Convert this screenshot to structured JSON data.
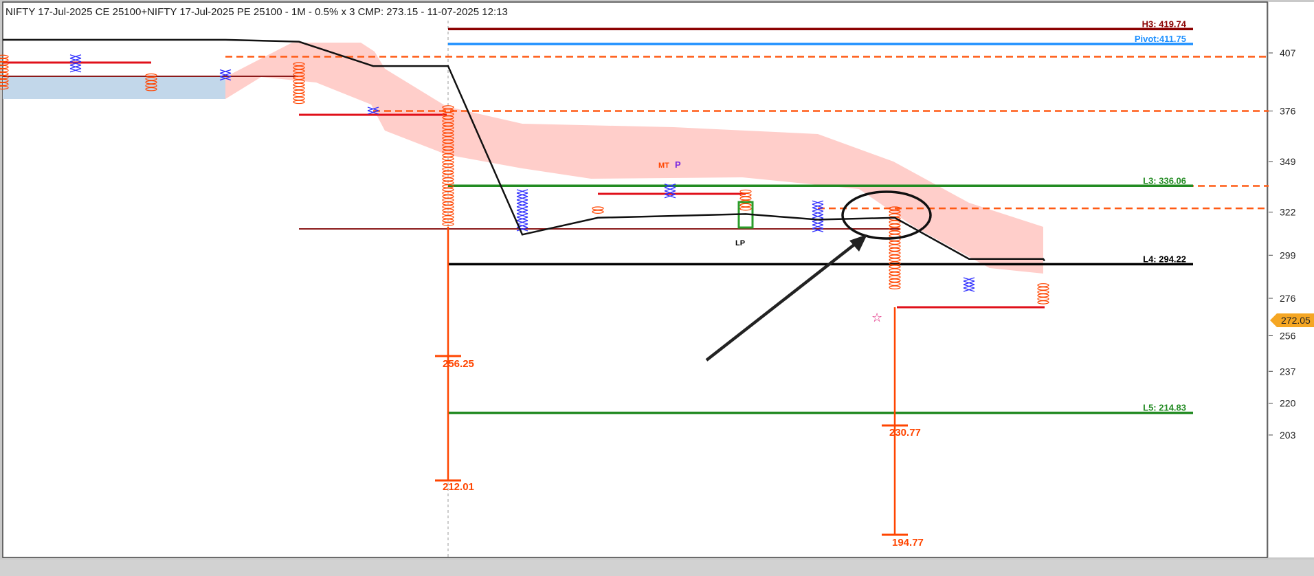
{
  "title": "NIFTY 17-Jul-2025 CE 25100+NIFTY 17-Jul-2025 PE 25100 - 1M - 0.5% x 3 CMP: 273.15 - 11-07-2025 12:13",
  "chart_data": {
    "type": "line",
    "ylim": [
      188,
      425
    ],
    "y_ticks": [
      407,
      376,
      349,
      322,
      299,
      276,
      256,
      237,
      220,
      203
    ],
    "current_price": "272.05",
    "colors": {
      "price_line": "#000000",
      "ribbon": "#ffc9c4",
      "dashed": "#ff5a14",
      "point_fig": "#ff4500",
      "x_mark": "#3333ff"
    },
    "price_line": [
      {
        "x": 0,
        "y": 414
      },
      {
        "x": 3,
        "y": 414
      },
      {
        "x": 4,
        "y": 413
      },
      {
        "x": 5,
        "y": 400
      },
      {
        "x": 6,
        "y": 400
      },
      {
        "x": 7,
        "y": 310
      },
      {
        "x": 8,
        "y": 319
      },
      {
        "x": 10,
        "y": 321
      },
      {
        "x": 11,
        "y": 318
      },
      {
        "x": 12,
        "y": 319
      },
      {
        "x": 13,
        "y": 297
      },
      {
        "x": 14,
        "y": 297
      },
      {
        "x": 15,
        "y": 296
      }
    ],
    "levels": [
      {
        "label": "H3: 419.74",
        "value": 419.74,
        "color": "#8b0000"
      },
      {
        "label": "Pivot:411.75",
        "value": 411.75,
        "color": "#1e90ff"
      },
      {
        "label": "L3: 336.06",
        "value": 336.06,
        "color": "#228b22"
      },
      {
        "label": "L4: 294.22",
        "value": 294.22,
        "color": "#000000"
      },
      {
        "label": "L5: 214.83",
        "value": 214.83,
        "color": "#228b22"
      }
    ],
    "dashed_levels": [
      405,
      376,
      336,
      324
    ],
    "support_points": [
      "256.25",
      "212.01",
      "230.77",
      "194.77"
    ],
    "annotations": {
      "lp": "LP",
      "mt": "MT",
      "p": "P"
    }
  }
}
